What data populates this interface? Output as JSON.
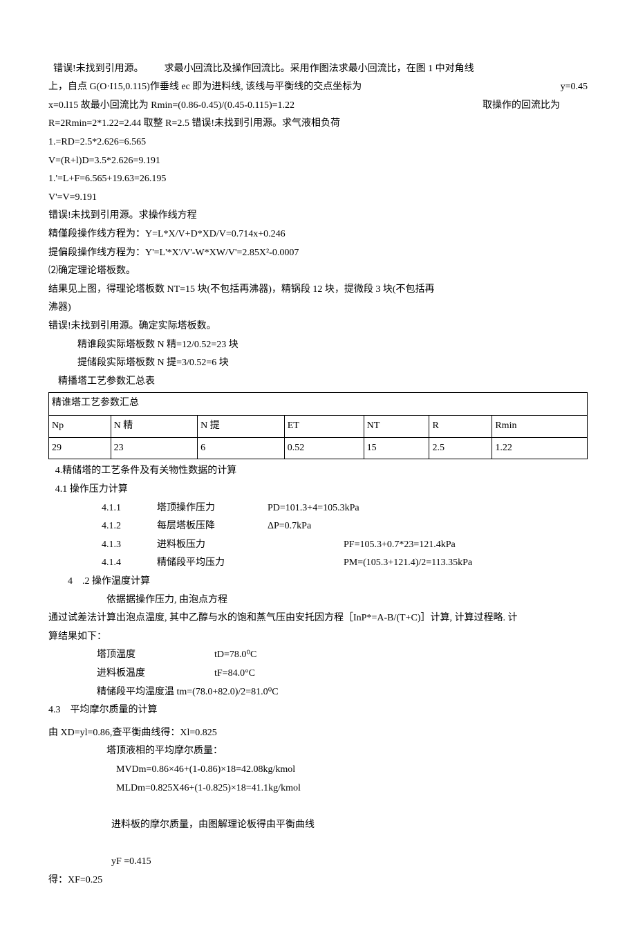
{
  "lines": {
    "l1a": "错误!未找到引用源。",
    "l1b": "求最小回流比及操作回流比。采用作图法求最小回流比，在图 1 中对角线",
    "l2a": "上，自点 G(O·I15,0.115)作垂线 ec 即为进料线, 该线与平衡线的交点坐标为",
    "l2b": "y=0.45",
    "l3a": "x=0.l15 故最小回流比为 Rmin=(0.86-0.45)/(0.45-0.115)=1.22",
    "l3b": "取操作的回流比为",
    "l4": "R=2Rmin=2*1.22=2.44 取整 R=2.5 错误!未找到引用源。求气液相负荷",
    "l5": "1.=RD=2.5*2.626=6.565",
    "l6": "V=(R+l)D=3.5*2.626=9.191",
    "l7": "1.'=L+F=6.565+19.63=26.195",
    "l8": "V'=V=9.191",
    "l9": "错误!未找到引用源。求操作线方程",
    "l10": "精僅段操作线方程为：Y=L*X/V+D*XD/V=0.714x+0.246",
    "l11": "提偏段操作线方程为：Y'=L'*X'/V'-W*XW/V'=2.85X²-0.0007",
    "l12": "⑵确定理论塔板数。",
    "l13": "结果见上图，得理论塔板数 NT=15 块(不包括再沸器)，精锅段 12 块，提微段 3 块(不包括再",
    "l14": "沸器)",
    "l15": "错误!未找到引用源。确定实际塔板数。",
    "l16": "精谁段实际塔板数 N 精=12/0.52=23 块",
    "l17": "提储段实际塔板数 N 提=3/0.52=6 块",
    "l18": "精播塔工艺参数汇总表"
  },
  "table": {
    "title": "精谁塔工艺参数汇总",
    "headers": [
      "Np",
      "N 精",
      "N 提",
      "ET",
      "NT",
      "R",
      "Rmin"
    ],
    "values": [
      "29",
      "23",
      "6",
      "0.52",
      "15",
      "2.5",
      "1.22"
    ]
  },
  "s4": {
    "t1": "4.精储塔的工艺条件及有关物性数据的计算",
    "t2": "4.1 操作压力计算",
    "r1": {
      "num": "4.1.1",
      "label": "塔顶操作压力",
      "val": "PD=101.3+4=105.3kPa"
    },
    "r2": {
      "num": "4.1.2",
      "label": "每层塔板压降",
      "val": "ΔP=0.7kPa"
    },
    "r3": {
      "num": "4.1.3",
      "label": "进料板压力",
      "val": "PF=105.3+0.7*23=121.4kPa"
    },
    "r4": {
      "num": "4.1.4",
      "label": "精储段平均压力",
      "val": "PM=(105.3+121.4)/2=113.35kPa"
    },
    "t3": "4    .2 操作温度计算",
    "t4": "依据据操作压力, 由泡点方程",
    "t5": "通过试差法计算出泡点温度, 其中乙醇与水的饱和蒸气压由安托因方程［InP*=A-B/(T+C)］计算, 计算过程略. 计",
    "t6": "算结果如下：",
    "r5": {
      "label": "塔顶温度",
      "val": "tD=78.0⁰C"
    },
    "r6": {
      "label": "进料板温度",
      "val": "tF=84.0°C"
    },
    "r7": "精储段平均温度温 tm=(78.0+82.0)/2=81.0⁰C",
    "t7": "4.3    平均摩尔质量的计算",
    "t8": "由 XD=yl=0.86,查平衡曲线得：Xl=0.825",
    "t9": "塔顶液相的平均摩尔质量：",
    "t10": "MVDm=0.86×46+(1-0.86)×18=42.08kg/kmol",
    "t11": "MLDm=0.825X46+(1-0.825)×18=41.1kg/kmol",
    "t12a": "进料板的摩尔质量，由图解理论板得由平衡曲线",
    "t12b": "yF =0.415",
    "t13": "得：XF=0.25"
  }
}
